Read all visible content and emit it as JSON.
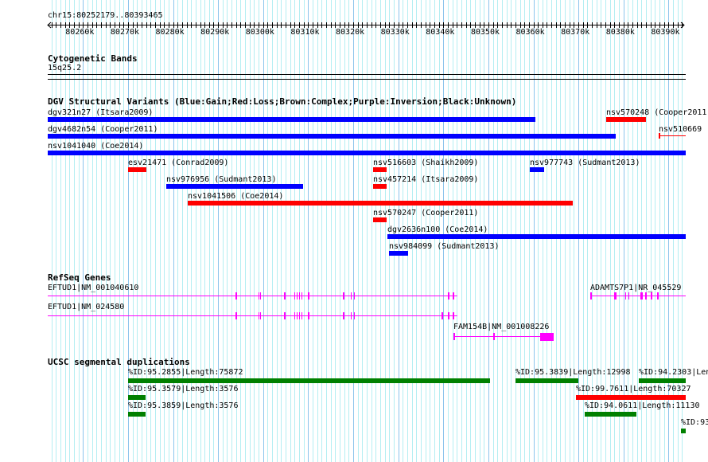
{
  "location": "chr15:80252179..80393465",
  "ruler": {
    "ticks": [
      "80260k",
      "80270k",
      "80280k",
      "80290k",
      "80300k",
      "80310k",
      "80320k",
      "80330k",
      "80340k",
      "80350k",
      "80360k",
      "80370k",
      "80380k",
      "80390k"
    ]
  },
  "cytoband": {
    "title": "Cytogenetic Bands",
    "band": "15q25.2"
  },
  "dgv": {
    "title": "DGV Structural Variants (Blue:Gain;Red:Loss;Brown:Complex;Purple:Inversion;Black:Unknown)",
    "colors": {
      "gain": "#0000ff",
      "loss": "#ff0000"
    },
    "features": [
      {
        "label": "dgv321n27 (Itsara2009)",
        "type": "gain"
      },
      {
        "label": "nsv570248 (Cooper2011)",
        "type": "loss"
      },
      {
        "label": "dgv4682n54 (Cooper2011)",
        "type": "gain"
      },
      {
        "label": "nsv510669 (",
        "type": "loss"
      },
      {
        "label": "nsv1041040 (Coe2014)",
        "type": "gain"
      },
      {
        "label": "esv21471 (Conrad2009)",
        "type": "loss"
      },
      {
        "label": "nsv516603 (Shaikh2009)",
        "type": "loss"
      },
      {
        "label": "nsv977743 (Sudmant2013)",
        "type": "gain"
      },
      {
        "label": "nsv976956 (Sudmant2013)",
        "type": "gain"
      },
      {
        "label": "nsv457214 (Itsara2009)",
        "type": "loss"
      },
      {
        "label": "nsv1041506 (Coe2014)",
        "type": "loss"
      },
      {
        "label": "nsv570247 (Cooper2011)",
        "type": "loss"
      },
      {
        "label": "dgv2636n100 (Coe2014)",
        "type": "gain"
      },
      {
        "label": "nsv984099 (Sudmant2013)",
        "type": "gain"
      }
    ]
  },
  "refseq": {
    "title": "RefSeq Genes",
    "color": "#ff00ff",
    "genes": [
      {
        "label": "EFTUD1|NM_001040610"
      },
      {
        "label": "EFTUD1|NM_024580"
      },
      {
        "label": "FAM154B|NM_001008226"
      },
      {
        "label": "ADAMTS7P1|NR_045529"
      }
    ]
  },
  "segdups": {
    "title": "UCSC segmental duplications",
    "features": [
      {
        "label": "%ID:95.2855|Length:75872",
        "color": "#008000"
      },
      {
        "label": "%ID:95.3839|Length:12998",
        "color": "#008000"
      },
      {
        "label": "%ID:94.2303|Len",
        "color": "#008000"
      },
      {
        "label": "%ID:95.3579|Length:3576",
        "color": "#008000"
      },
      {
        "label": "%ID:99.7611|Length:70327",
        "color": "#ff0000"
      },
      {
        "label": "%ID:95.3859|Length:3576",
        "color": "#008000"
      },
      {
        "label": "%ID:94.0611|Length:11130",
        "color": "#008000"
      },
      {
        "label": "%ID:93",
        "color": "#008000"
      }
    ]
  }
}
